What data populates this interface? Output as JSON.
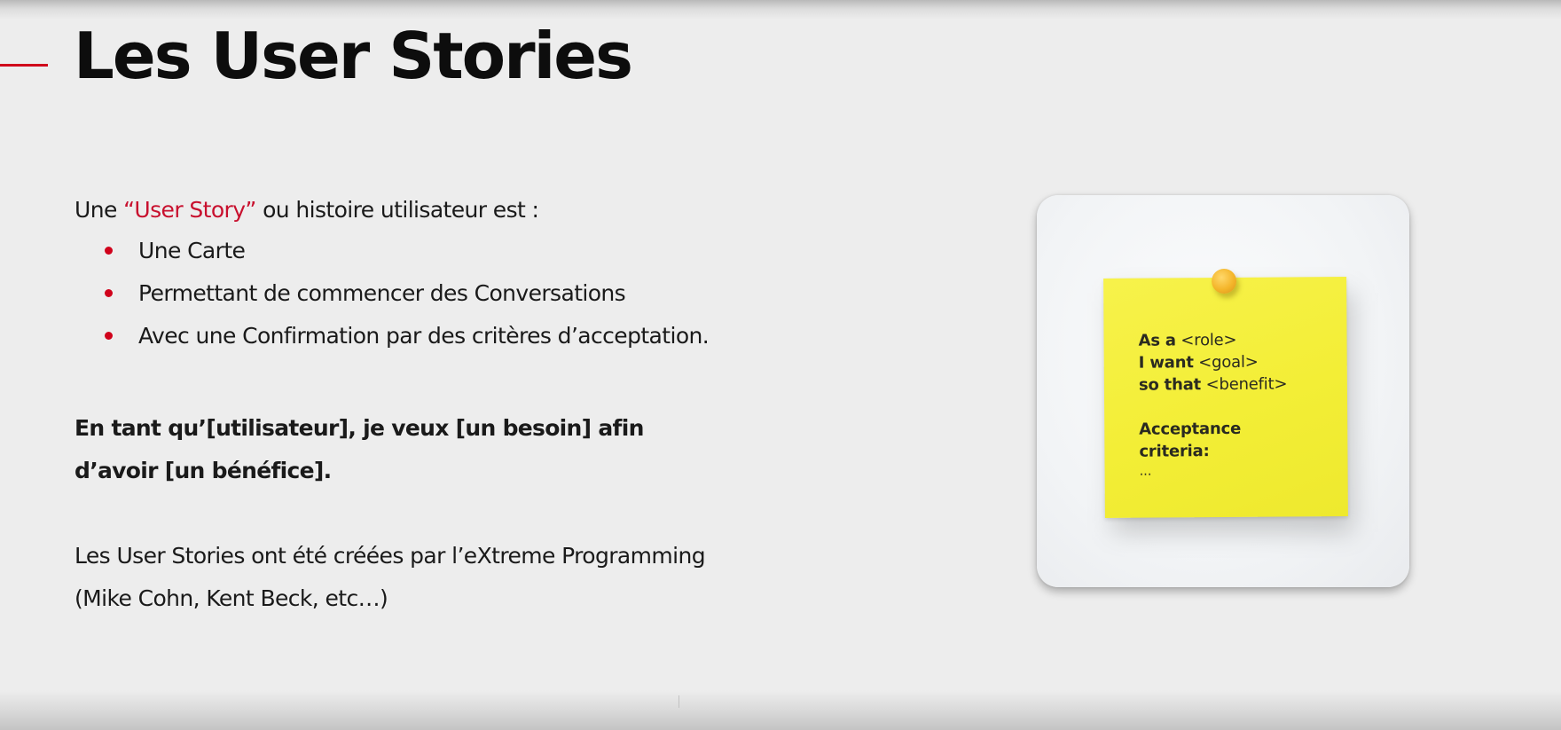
{
  "slide": {
    "title": "Les User Stories",
    "intro": {
      "prefix": "Une ",
      "highlight": "“User Story”",
      "suffix": " ou histoire utilisateur est :"
    },
    "bullets": [
      "Une Carte",
      "Permettant de commencer des Conversations",
      "Avec une Confirmation par des critères d’acceptation."
    ],
    "statement_line1": "En tant qu’[utilisateur], je veux [un besoin] afin",
    "statement_line2": "d’avoir [un bénéfice].",
    "origin_line1": "Les User Stories ont été créées par l’eXtreme Programming",
    "origin_line2": "(Mike Cohn, Kent Beck, etc…)"
  },
  "sticky_note": {
    "line1_bold": "As a",
    "line1_rest": " <role>",
    "line2_bold": "I want",
    "line2_rest": " <goal>",
    "line3_bold": "so that",
    "line3_rest": " <benefit>",
    "criteria_line1": "Acceptance",
    "criteria_line2": "criteria:",
    "ellipsis": "..."
  },
  "colors": {
    "accent": "#d0021b",
    "background": "#ededed",
    "note": "#f3ee36"
  }
}
